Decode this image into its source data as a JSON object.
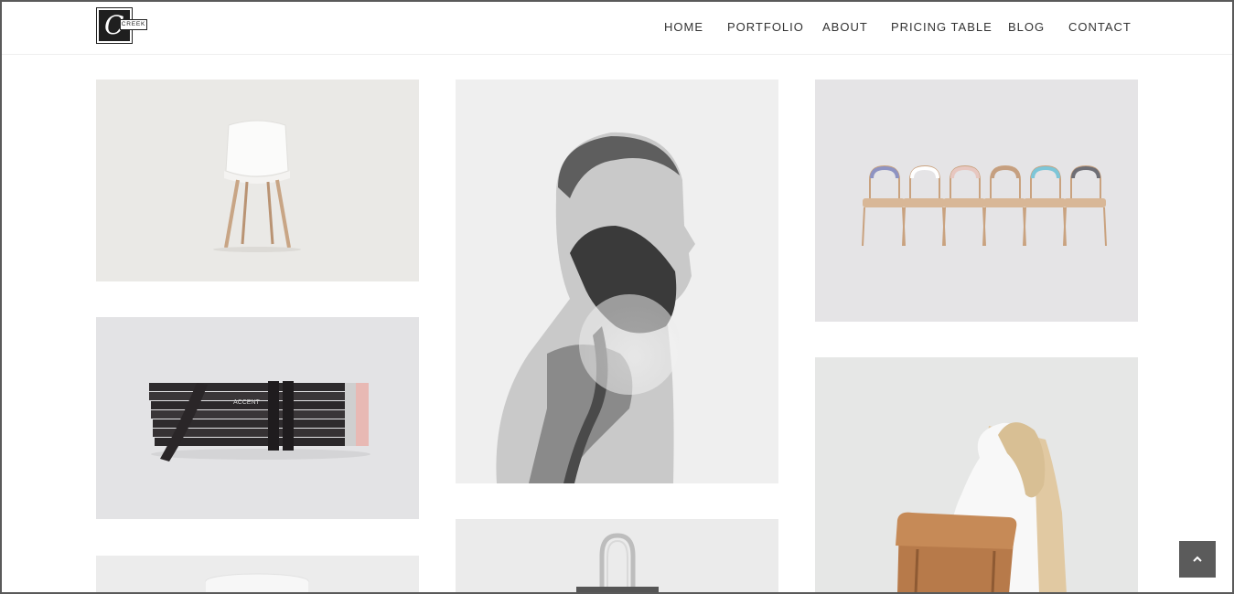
{
  "logo": {
    "letter": "C",
    "word": "CREEK"
  },
  "nav": [
    {
      "label": "HOME",
      "name": "nav-home"
    },
    {
      "label": "PORTFOLIO",
      "name": "nav-portfolio"
    },
    {
      "label": "ABOUT",
      "name": "nav-about"
    },
    {
      "label": "PRICING TABLE",
      "name": "nav-pricing-table"
    },
    {
      "label": "BLOG",
      "name": "nav-blog"
    },
    {
      "label": "CONTACT",
      "name": "nav-contact"
    }
  ],
  "portfolio": [
    {
      "name": "portfolio-item-white-chair",
      "subject": "white-chair",
      "bg": "#eae9e6"
    },
    {
      "name": "portfolio-item-pencil-bundle",
      "subject": "pencil-bundle",
      "bg": "#e3e3e5"
    },
    {
      "name": "portfolio-item-white-cup",
      "subject": "white-cup",
      "bg": "#ececec"
    },
    {
      "name": "portfolio-item-bearded-man",
      "subject": "bearded-man",
      "bg": "#efefef"
    },
    {
      "name": "portfolio-item-tote-bag",
      "subject": "tote-bag",
      "bg": "#ebebeb"
    },
    {
      "name": "portfolio-item-windsor-chairs",
      "subject": "windsor-chairs",
      "bg": "#e5e4e6"
    },
    {
      "name": "portfolio-item-leather-backpack",
      "subject": "leather-backpack",
      "bg": "#e6e7e6"
    }
  ],
  "pencil_text": "ACCENT",
  "back_to_top": {
    "icon": "chevron-up-icon"
  },
  "colors": {
    "nav_text": "#333333",
    "to_top_bg": "#5b5b5b",
    "leather": "#b77a4a"
  }
}
